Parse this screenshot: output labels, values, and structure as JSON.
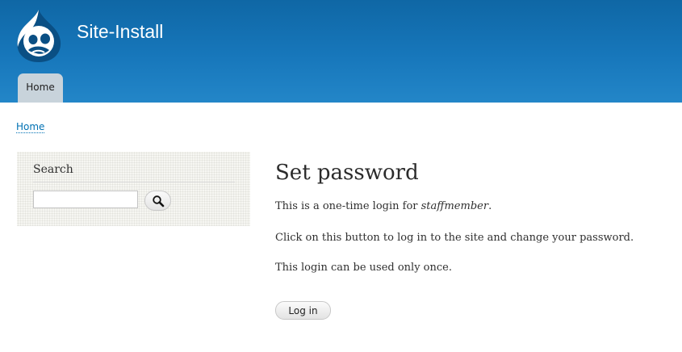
{
  "header": {
    "site_name": "Site-Install",
    "logo_icon": "drupal-drop-logo",
    "nav": [
      {
        "label": "Home",
        "active": true
      }
    ]
  },
  "breadcrumb": {
    "home_label": "Home"
  },
  "sidebar": {
    "search": {
      "title": "Search",
      "input_value": "",
      "button_icon": "magnifier-icon"
    }
  },
  "main": {
    "title": "Set password",
    "intro_prefix": "This is a one-time login for ",
    "username": "staffmember",
    "intro_suffix": ".",
    "instruction": "Click on this button to log in to the site and change your password.",
    "note": "This login can be used only once.",
    "login_button": "Log in"
  },
  "colors": {
    "header_top": "#0f67a5",
    "header_bottom": "#2386c8",
    "tab_background": "#c8d3db",
    "link": "#0071b3"
  }
}
